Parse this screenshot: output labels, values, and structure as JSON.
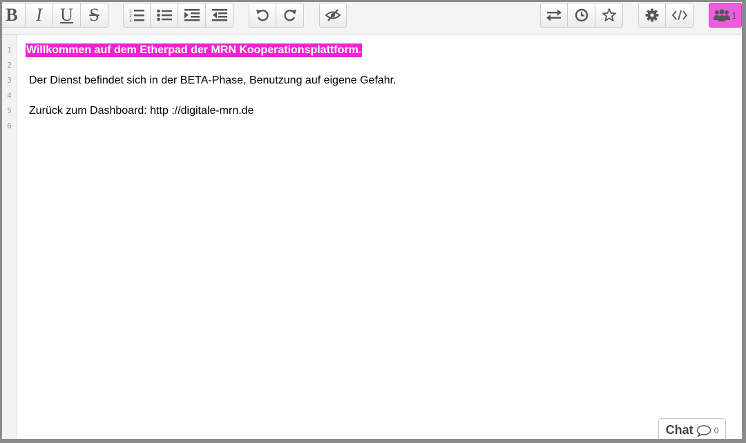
{
  "toolbar": {
    "format": {
      "bold": "B",
      "italic": "I",
      "underline": "U",
      "strikethrough": "S"
    },
    "list_buttons": [
      "ordered-list-icon",
      "unordered-list-icon",
      "indent-icon",
      "outdent-icon"
    ],
    "history_buttons": [
      "undo-icon",
      "redo-icon"
    ],
    "visibility_button": "eye-slash-icon",
    "right_buttons": [
      "import-export-icon",
      "timeslider-icon",
      "star-icon"
    ],
    "settings_buttons": [
      "gear-icon",
      "embed-icon"
    ],
    "users": {
      "icon": "users-icon",
      "count": "1",
      "color": "#ee5de0"
    }
  },
  "editor": {
    "line_numbers": [
      "1",
      "2",
      "3",
      "4",
      "5",
      "6"
    ],
    "lines": [
      "Willkommen auf dem Etherpad der MRN Kooperationsplattform.",
      "",
      "Der Dienst befindet sich in der BETA-Phase, Benutzung auf eigene Gefahr.",
      "",
      "Zurück zum Dashboard: http ://digitale-mrn.de",
      ""
    ],
    "highlight_color": "#ee24d4"
  },
  "chat": {
    "label": "Chat",
    "count": "0",
    "icon": "speech-bubble-icon"
  }
}
